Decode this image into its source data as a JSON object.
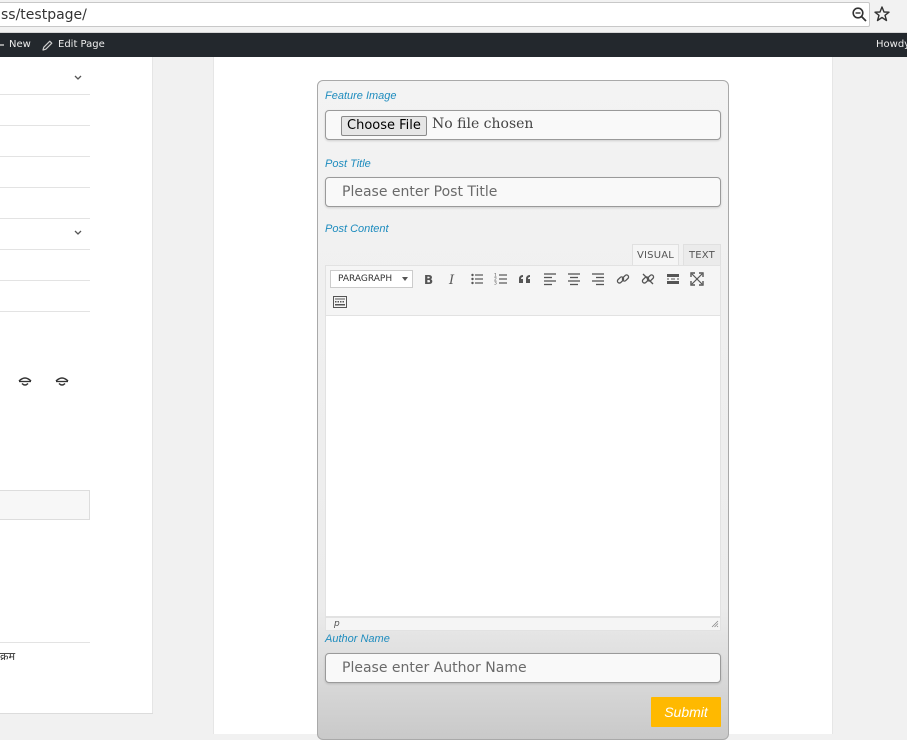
{
  "browser": {
    "url": "ss/testpage/",
    "zoom_icon": "zoom-out-icon",
    "bookmark_icon": "star-icon"
  },
  "adminbar": {
    "new_label": "New",
    "edit_label": "Edit Page",
    "howdy": "Howdy,"
  },
  "sidebar": {
    "text": "क्रम"
  },
  "form": {
    "feature_image_label": "Feature Image",
    "choose_file_label": "Choose File",
    "no_file_text": "No file chosen",
    "post_title_label": "Post Title",
    "post_title_placeholder": "Please enter Post Title",
    "post_content_label": "Post Content",
    "tab_visual": "VISUAL",
    "tab_text": "TEXT",
    "format_select": "PARAGRAPH",
    "editor_path": "p",
    "author_label": "Author Name",
    "author_placeholder": "Please enter Author Name",
    "submit_label": "Submit",
    "accent_color": "#ffb900",
    "label_color": "#1e8cbe"
  }
}
